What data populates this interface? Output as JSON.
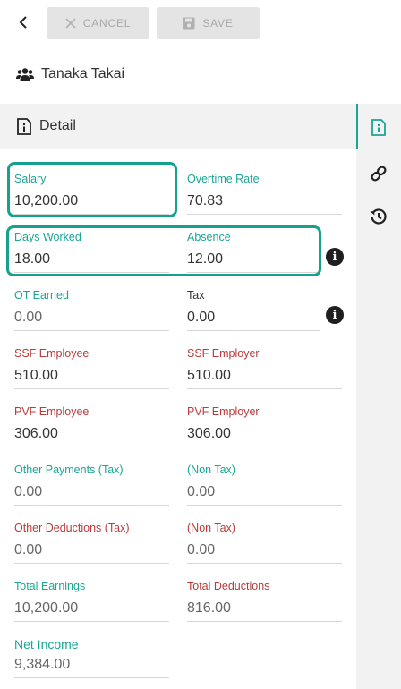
{
  "toolbar": {
    "back_icon": "chevron-left-icon",
    "cancel_label": "CANCEL",
    "save_label": "SAVE"
  },
  "employee": {
    "name": "Tanaka Takai",
    "icon": "users-icon"
  },
  "section": {
    "title": "Detail",
    "icon": "info-document-icon"
  },
  "rail": {
    "items": [
      "detail-icon",
      "link-icon",
      "history-icon"
    ],
    "accent": "#1aa594"
  },
  "fields": {
    "salary": {
      "label": "Salary",
      "value": "10,200.00"
    },
    "overtime_rate": {
      "label": "Overtime Rate",
      "value": "70.83"
    },
    "days_worked": {
      "label": "Days Worked",
      "value": "18.00"
    },
    "absence": {
      "label": "Absence",
      "value": "12.00"
    },
    "ot_earned": {
      "label": "OT Earned",
      "value": "0.00"
    },
    "tax": {
      "label": "Tax",
      "value": "0.00"
    },
    "ssf_employee": {
      "label": "SSF Employee",
      "value": "510.00"
    },
    "ssf_employer": {
      "label": "SSF Employer",
      "value": "510.00"
    },
    "pvf_employee": {
      "label": "PVF Employee",
      "value": "306.00"
    },
    "pvf_employer": {
      "label": "PVF Employer",
      "value": "306.00"
    },
    "other_payments_tax": {
      "label": "Other Payments (Tax)",
      "value": "0.00"
    },
    "other_payments_non_tax": {
      "label": "(Non Tax)",
      "value": "0.00"
    },
    "other_deductions_tax": {
      "label": "Other Deductions (Tax)",
      "value": "0.00"
    },
    "other_deductions_non_tax": {
      "label": "(Non Tax)",
      "value": "0.00"
    },
    "total_earnings": {
      "label": "Total Earnings",
      "value": "10,200.00"
    },
    "total_deductions": {
      "label": "Total Deductions",
      "value": "816.00"
    },
    "net_income": {
      "label": "Net Income",
      "value": "9,384.00"
    }
  },
  "colors": {
    "teal": "#1aa594",
    "red": "#b93b3b",
    "highlight": "#15a18e"
  }
}
